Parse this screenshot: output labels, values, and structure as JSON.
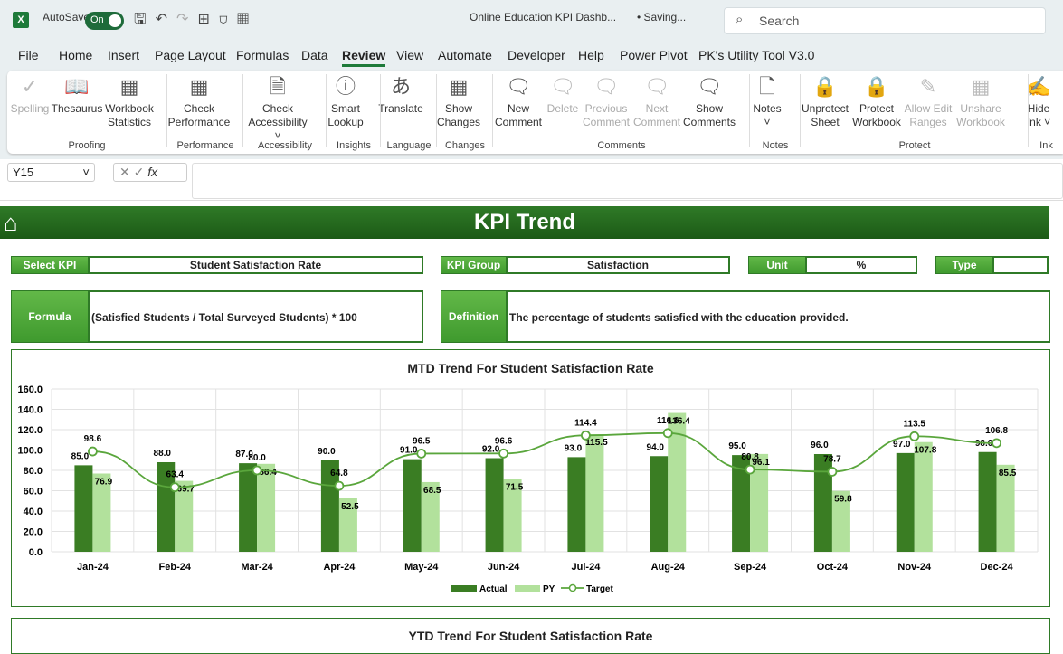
{
  "titlebar": {
    "autosave": "AutoSave",
    "toggle": "On",
    "doc_title": "Online Education KPI Dashb...",
    "status": "• Saving...",
    "search_placeholder": "Search"
  },
  "tabs": [
    "File",
    "Home",
    "Insert",
    "Page Layout",
    "Formulas",
    "Data",
    "Review",
    "View",
    "Automate",
    "Developer",
    "Help",
    "Power Pivot",
    "PK's Utility Tool V3.0"
  ],
  "active_tab": "Review",
  "ribbon": {
    "buttons": [
      {
        "l1": "Spelling",
        "l2": "",
        "icon": "spelling-icon",
        "g": "✓",
        "dis": true
      },
      {
        "l1": "Thesaurus",
        "l2": "",
        "icon": "thesaurus-icon",
        "g": "📖"
      },
      {
        "l1": "Workbook",
        "l2": "Statistics",
        "icon": "workbook-statistics-icon",
        "g": "▦"
      },
      {
        "l1": "Check",
        "l2": "Performance",
        "icon": "check-performance-icon",
        "g": "▦"
      },
      {
        "l1": "Check",
        "l2": "Accessibility ˅",
        "icon": "check-accessibility-icon",
        "g": "🗎"
      },
      {
        "l1": "Smart",
        "l2": "Lookup",
        "icon": "smart-lookup-icon",
        "g": "ⓘ"
      },
      {
        "l1": "Translate",
        "l2": "",
        "icon": "translate-icon",
        "g": "あ"
      },
      {
        "l1": "Show",
        "l2": "Changes",
        "icon": "show-changes-icon",
        "g": "▦"
      },
      {
        "l1": "New",
        "l2": "Comment",
        "icon": "new-comment-icon",
        "g": "🗨"
      },
      {
        "l1": "Delete",
        "l2": "",
        "icon": "delete-comment-icon",
        "g": "🗨",
        "dis": true
      },
      {
        "l1": "Previous",
        "l2": "Comment",
        "icon": "previous-comment-icon",
        "g": "🗨",
        "dis": true
      },
      {
        "l1": "Next",
        "l2": "Comment",
        "icon": "next-comment-icon",
        "g": "🗨",
        "dis": true
      },
      {
        "l1": "Show",
        "l2": "Comments",
        "icon": "show-comments-icon",
        "g": "🗨"
      },
      {
        "l1": "Notes",
        "l2": "˅",
        "icon": "notes-icon",
        "g": "🗋"
      },
      {
        "l1": "Unprotect",
        "l2": "Sheet",
        "icon": "unprotect-sheet-icon",
        "g": "🔒"
      },
      {
        "l1": "Protect",
        "l2": "Workbook",
        "icon": "protect-workbook-icon",
        "g": "🔒"
      },
      {
        "l1": "Allow Edit",
        "l2": "Ranges",
        "icon": "allow-edit-ranges-icon",
        "g": "✎",
        "dis": true
      },
      {
        "l1": "Unshare",
        "l2": "Workbook",
        "icon": "unshare-workbook-icon",
        "g": "▦",
        "dis": true
      },
      {
        "l1": "Hide",
        "l2": "Ink ˅",
        "icon": "hide-ink-icon",
        "g": "✍"
      }
    ],
    "groups": [
      "Proofing",
      "Performance",
      "Accessibility",
      "Insights",
      "Language",
      "Changes",
      "Comments",
      "Notes",
      "Protect",
      "Ink"
    ]
  },
  "name_box": "Y15",
  "sheet": {
    "banner": "KPI Trend",
    "select_kpi_label": "Select KPI",
    "select_kpi_value": "Student Satisfaction Rate",
    "kpi_group_label": "KPI Group",
    "kpi_group_value": "Satisfaction",
    "unit_label": "Unit",
    "unit_value": "%",
    "type_label": "Type",
    "type_value": "",
    "formula_label": "Formula",
    "formula_value": "(Satisfied Students / Total Surveyed Students) * 100",
    "definition_label": "Definition",
    "definition_value": "The percentage of students satisfied with the education provided.",
    "ytd_title": "YTD Trend For Student Satisfaction Rate"
  },
  "colors": {
    "actual": "#3a7d23",
    "py": "#b2e19c",
    "target": "#5aa63c",
    "banner": "#2a6e22"
  },
  "chart_data": {
    "type": "bar",
    "title": "MTD Trend For Student Satisfaction Rate",
    "categories": [
      "Jan-24",
      "Feb-24",
      "Mar-24",
      "Apr-24",
      "May-24",
      "Jun-24",
      "Jul-24",
      "Aug-24",
      "Sep-24",
      "Oct-24",
      "Nov-24",
      "Dec-24"
    ],
    "ylim": [
      0,
      160
    ],
    "yticks": [
      "0.0",
      "20.0",
      "40.0",
      "60.0",
      "80.0",
      "100.0",
      "120.0",
      "140.0",
      "160.0"
    ],
    "grid": true,
    "legend": "bottom",
    "series": [
      {
        "name": "Actual",
        "type": "bar",
        "values": [
          85.0,
          88.0,
          87.0,
          90.0,
          91.0,
          92.0,
          93.0,
          94.0,
          95.0,
          96.0,
          97.0,
          98.0
        ]
      },
      {
        "name": "PY",
        "type": "bar",
        "values": [
          76.9,
          69.7,
          86.4,
          52.5,
          68.5,
          71.5,
          115.5,
          136.4,
          96.1,
          59.8,
          107.8,
          85.5
        ]
      },
      {
        "name": "Target",
        "type": "line",
        "values": [
          98.6,
          63.4,
          80.0,
          64.8,
          96.5,
          96.6,
          114.4,
          116.6,
          80.8,
          78.7,
          113.5,
          106.8
        ]
      }
    ]
  }
}
